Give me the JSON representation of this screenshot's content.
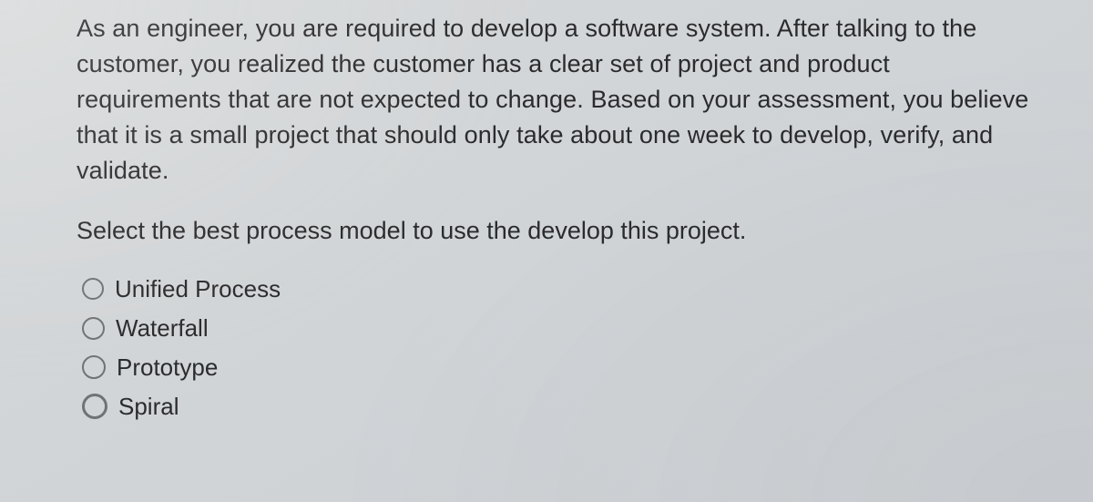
{
  "question": {
    "stem": "As an engineer, you are required to develop a software system. After talking to the customer, you realized the customer has a clear set of project and product requirements that are not expected to change. Based on your assessment, you believe that it is a small project that should only take about one week to develop, verify, and validate.",
    "prompt": "Select the best process model to use the develop this project."
  },
  "options": {
    "0": {
      "label": "Unified Process"
    },
    "1": {
      "label": "Waterfall"
    },
    "2": {
      "label": "Prototype"
    },
    "3": {
      "label": "Spiral"
    }
  }
}
